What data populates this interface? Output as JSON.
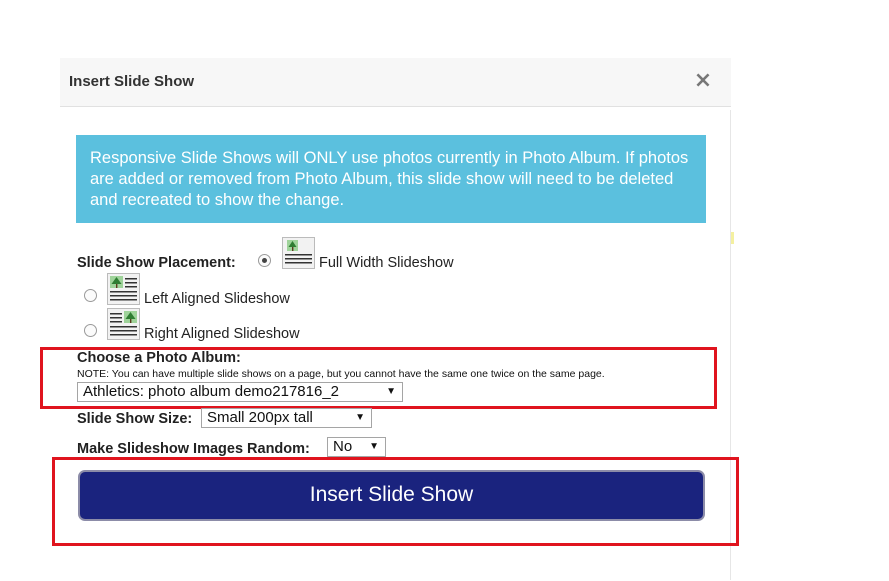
{
  "dialog": {
    "title": "Insert Slide Show",
    "close_glyph": "×"
  },
  "info": {
    "text": "Responsive Slide Shows will ONLY use photos currently in Photo Album. If photos are added or removed from Photo Album, this slide show will need to be deleted and recreated to show the change."
  },
  "placement": {
    "label": "Slide Show Placement:",
    "options": [
      {
        "label": "Full Width Slideshow",
        "selected": true,
        "icon": "full-width-layout-icon"
      },
      {
        "label": "Left Aligned Slideshow",
        "selected": false,
        "icon": "left-aligned-layout-icon"
      },
      {
        "label": "Right Aligned Slideshow",
        "selected": false,
        "icon": "right-aligned-layout-icon"
      }
    ]
  },
  "album": {
    "label": "Choose a Photo Album:",
    "note": "NOTE: You can have multiple slide shows on a page, but you cannot have the same one twice on the same page.",
    "selected": "Athletics: photo album demo217816_2"
  },
  "size": {
    "label": "Slide Show Size:",
    "selected": "Small 200px tall"
  },
  "random": {
    "label": "Make Slideshow Images Random:",
    "selected": "No"
  },
  "submit": {
    "label": "Insert Slide Show"
  },
  "colors": {
    "info_bg": "#5bc0de",
    "button_bg": "#1a237e",
    "highlight": "#e0141e"
  }
}
